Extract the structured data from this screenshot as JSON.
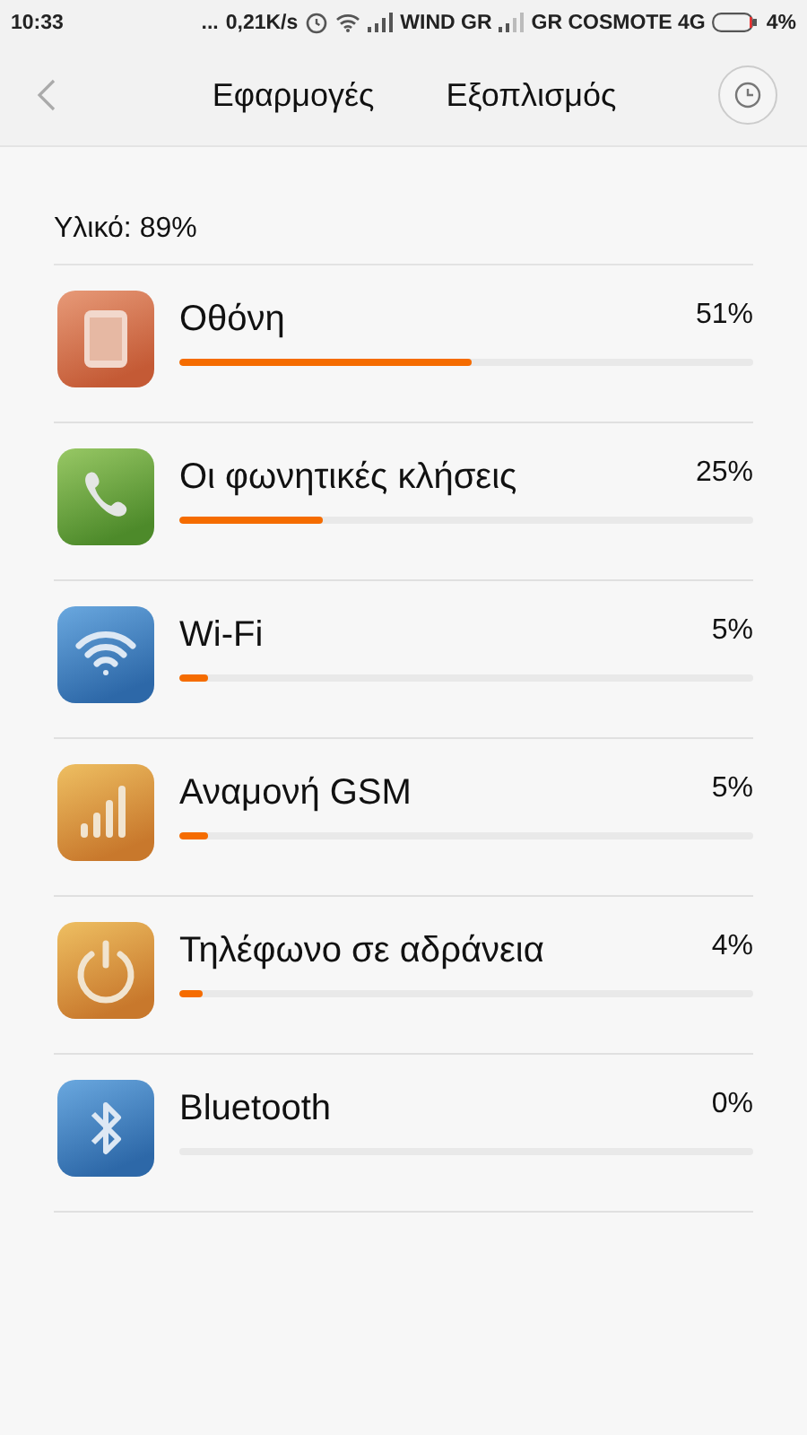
{
  "status_bar": {
    "time": "10:33",
    "dots": "...",
    "speed": "0,21K/s",
    "carrier_1": "WIND GR",
    "carrier_2": "GR COSMOTE 4G",
    "battery": "4%"
  },
  "header": {
    "tabs": [
      {
        "label": "Εφαρμογές"
      },
      {
        "label": "Εξοπλισμός"
      }
    ]
  },
  "summary": "Υλικό: 89%",
  "items": [
    {
      "kind": "screen",
      "name": "Οθόνη",
      "percent": "51%",
      "level": 0.51
    },
    {
      "kind": "call",
      "name": "Οι φωνητικές κλήσεις",
      "percent": "25%",
      "level": 0.25
    },
    {
      "kind": "wifi",
      "name": "Wi-Fi",
      "percent": "5%",
      "level": 0.05
    },
    {
      "kind": "signal",
      "name": "Αναμονή GSM",
      "percent": "5%",
      "level": 0.05
    },
    {
      "kind": "power",
      "name": "Τηλέφωνο σε αδράνεια",
      "percent": "4%",
      "level": 0.04
    },
    {
      "kind": "bluetooth",
      "name": "Bluetooth",
      "percent": "0%"
    }
  ]
}
